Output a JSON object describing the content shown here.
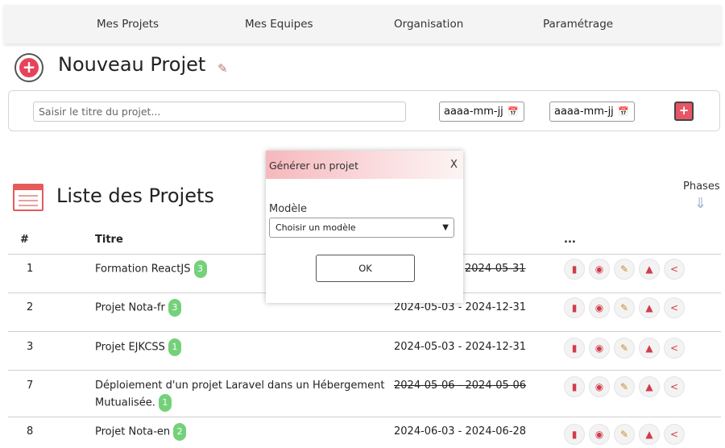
{
  "nav": {
    "items": [
      "Mes Projets",
      "Mes Equipes",
      "Organisation",
      "Paramétrage"
    ]
  },
  "new_project": {
    "title": "Nouveau Projet",
    "title_placeholder": "Saisir le titre du projet...",
    "date_placeholder": "aaaa-mm-jj",
    "add_label": "+"
  },
  "list": {
    "title": "Liste des Projets",
    "phases_label": "Phases",
    "headers": {
      "num": "#",
      "title": "Titre",
      "actions": "..."
    },
    "rows": [
      {
        "num": "1",
        "title": "Formation ReactJS",
        "badge": "3",
        "dates": "2024-05-31",
        "dates_struck": true
      },
      {
        "num": "2",
        "title": "Projet Nota-fr",
        "badge": "3",
        "dates": "2024-05-03 - 2024-12-31",
        "dates_struck": false
      },
      {
        "num": "3",
        "title": "Projet EJKCSS",
        "badge": "1",
        "dates": "2024-05-03 - 2024-12-31",
        "dates_struck": false
      },
      {
        "num": "7",
        "title_line1": "Déploiement d'un projet Laravel dans un Hébergement",
        "title_line2": "Mutualisée.",
        "badge": "1",
        "dates": "2024-05-06 - 2024-05-06",
        "dates_struck": true
      },
      {
        "num": "8",
        "title": "Projet Nota-en",
        "badge": "2",
        "dates": "2024-06-03 - 2024-06-28",
        "dates_struck": false
      }
    ],
    "action_icons": [
      "pdf-icon",
      "presentation-icon",
      "edit-icon",
      "trash-icon",
      "share-icon"
    ]
  },
  "modal": {
    "title": "Générer un projet",
    "close": "X",
    "label": "Modèle",
    "select_value": "Choisir un modèle",
    "ok": "OK"
  },
  "colors": {
    "accent": "#e8425b",
    "badge": "#74d17a",
    "action_icon": "#d23c4a"
  }
}
